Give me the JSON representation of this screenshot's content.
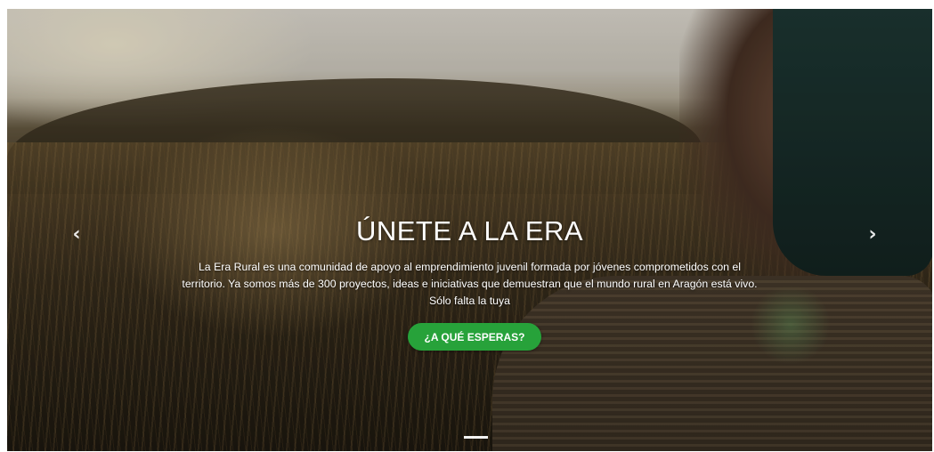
{
  "hero": {
    "title": "ÚNETE A LA ERA",
    "description_lines": [
      "La Era Rural es una comunidad de apoyo al emprendimiento juvenil formada por jóvenes comprometidos con el",
      "territorio. Ya somos más de 300 proyectos, ideas e iniciativas que demuestran que el mundo rural en Aragón está vivo.",
      "Sólo falta la tuya"
    ],
    "cta_label": "¿A QUÉ ESPERAS?",
    "cta_color": "#27a23a",
    "prev_icon": "chevron-left-icon",
    "next_icon": "chevron-right-icon",
    "prev_glyph": "‹",
    "next_glyph": "›",
    "slide_count": 1,
    "active_slide": 1
  }
}
